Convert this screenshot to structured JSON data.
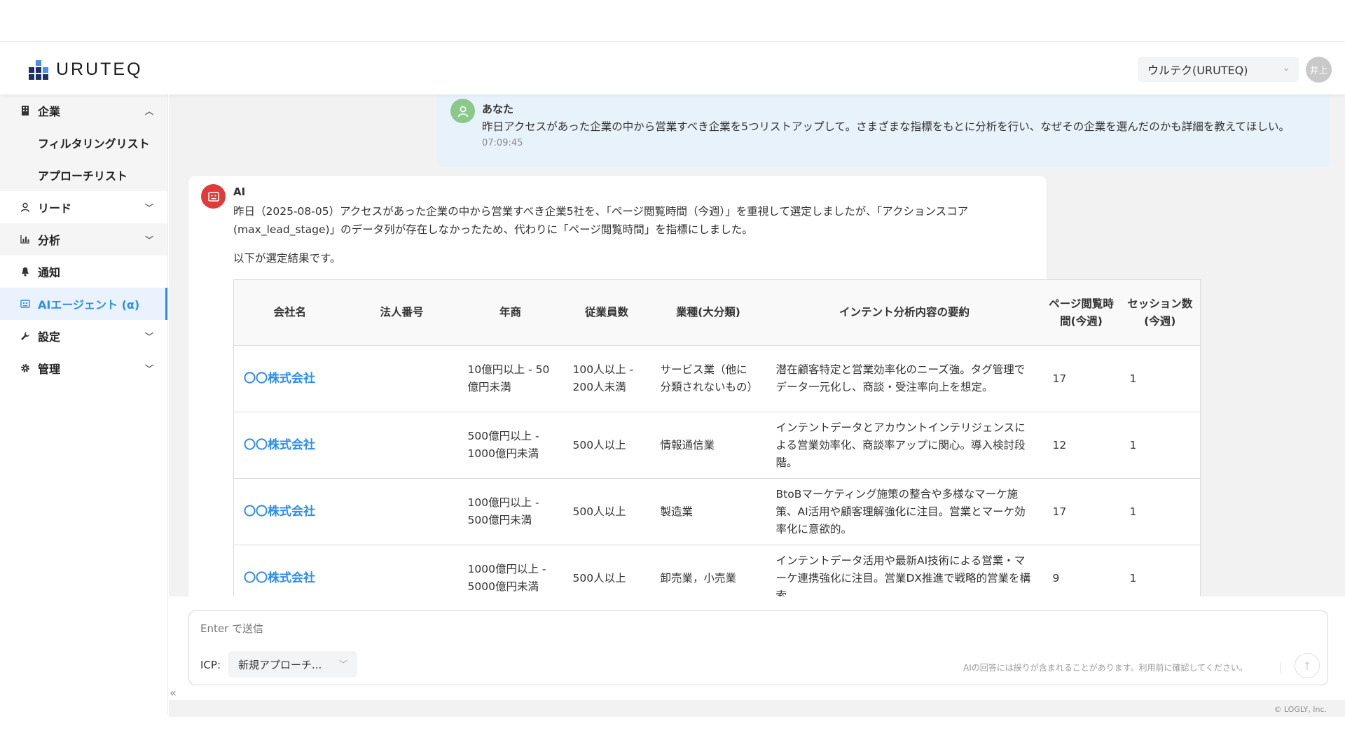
{
  "header": {
    "logo_text": "URUTEQ",
    "org_selector": "ウルテク(URUTEQ)",
    "avatar_initials": "井上"
  },
  "sidebar": {
    "items": [
      {
        "label": "企業",
        "icon": "building-icon",
        "expanded": true
      },
      {
        "label": "フィルタリングリスト",
        "sub": true
      },
      {
        "label": "アプローチリスト",
        "sub": true
      },
      {
        "label": "リード",
        "icon": "person-icon"
      },
      {
        "label": "分析",
        "icon": "bar-chart-icon"
      },
      {
        "label": "通知",
        "icon": "bell-icon"
      },
      {
        "label": "AIエージェント (α)",
        "icon": "robot-icon",
        "active": true
      },
      {
        "label": "設定",
        "icon": "wrench-icon"
      },
      {
        "label": "管理",
        "icon": "gear-icon"
      }
    ],
    "collapse_glyph": "«"
  },
  "chat": {
    "user": {
      "name": "あなた",
      "message": "昨日アクセスがあった企業の中から営業すべき企業を5つリストアップして。さまざまな指標をもとに分析を行い、なぜその企業を選んだのかも詳細を教えてほしい。",
      "time": "07:09:45"
    },
    "ai": {
      "name": "AI",
      "message": "昨日（2025-08-05）アクセスがあった企業の中から営業すべき企業5社を、「ページ閲覧時間（今週）」を重視して選定しましたが、「アクションスコア(max_lead_stage)」のデータ列が存在しなかったため、代わりに「ページ閲覧時間」を指標にしました。",
      "intro": "以下が選定結果です。"
    }
  },
  "table": {
    "headers": [
      "会社名",
      "法人番号",
      "年商",
      "従業員数",
      "業種(大分類)",
      "インテント分析内容の要約",
      "ページ閲覧時間(今週)",
      "セッション数(今週)"
    ],
    "rows": [
      [
        "〇〇株式会社",
        "",
        "10億円以上 - 50億円未満",
        "100人以上 - 200人未満",
        "サービス業（他に分類されないもの）",
        "潜在顧客特定と営業効率化のニーズ強。タグ管理でデータ一元化し、商談・受注率向上を想定。",
        "17",
        "1"
      ],
      [
        "〇〇株式会社",
        "",
        "500億円以上 - 1000億円未満",
        "500人以上",
        "情報通信業",
        "インテントデータとアカウントインテリジェンスによる営業効率化、商談率アップに関心。導入検討段階。",
        "12",
        "1"
      ],
      [
        "〇〇株式会社",
        "",
        "100億円以上 - 500億円未満",
        "500人以上",
        "製造業",
        "BtoBマーケティング施策の整合や多様なマーケ施策、AI活用や顧客理解強化に注目。営業とマーケ効率化に意欲的。",
        "17",
        "1"
      ],
      [
        "〇〇株式会社",
        "",
        "1000億円以上 - 5000億円未満",
        "500人以上",
        "卸売業，小売業",
        "インテントデータ活用や最新AI技術による営業・マーケ連携強化に注目。営業DX推進で戦略的営業を構索。",
        "9",
        "1"
      ]
    ]
  },
  "composer": {
    "placeholder": "Enter で送信",
    "icp_label": "ICP:",
    "icp_value": "新規アプローチ...",
    "disclaimer": "AIの回答には誤りが含まれることがあります。利用前に確認してください。"
  },
  "footer": {
    "copyright": "© LOGLY, Inc."
  },
  "colors": {
    "accent": "#2d8cf0",
    "ai_avatar": "#e03a3a",
    "user_avatar": "#8bc98a",
    "user_bubble": "#e8f2fb"
  }
}
